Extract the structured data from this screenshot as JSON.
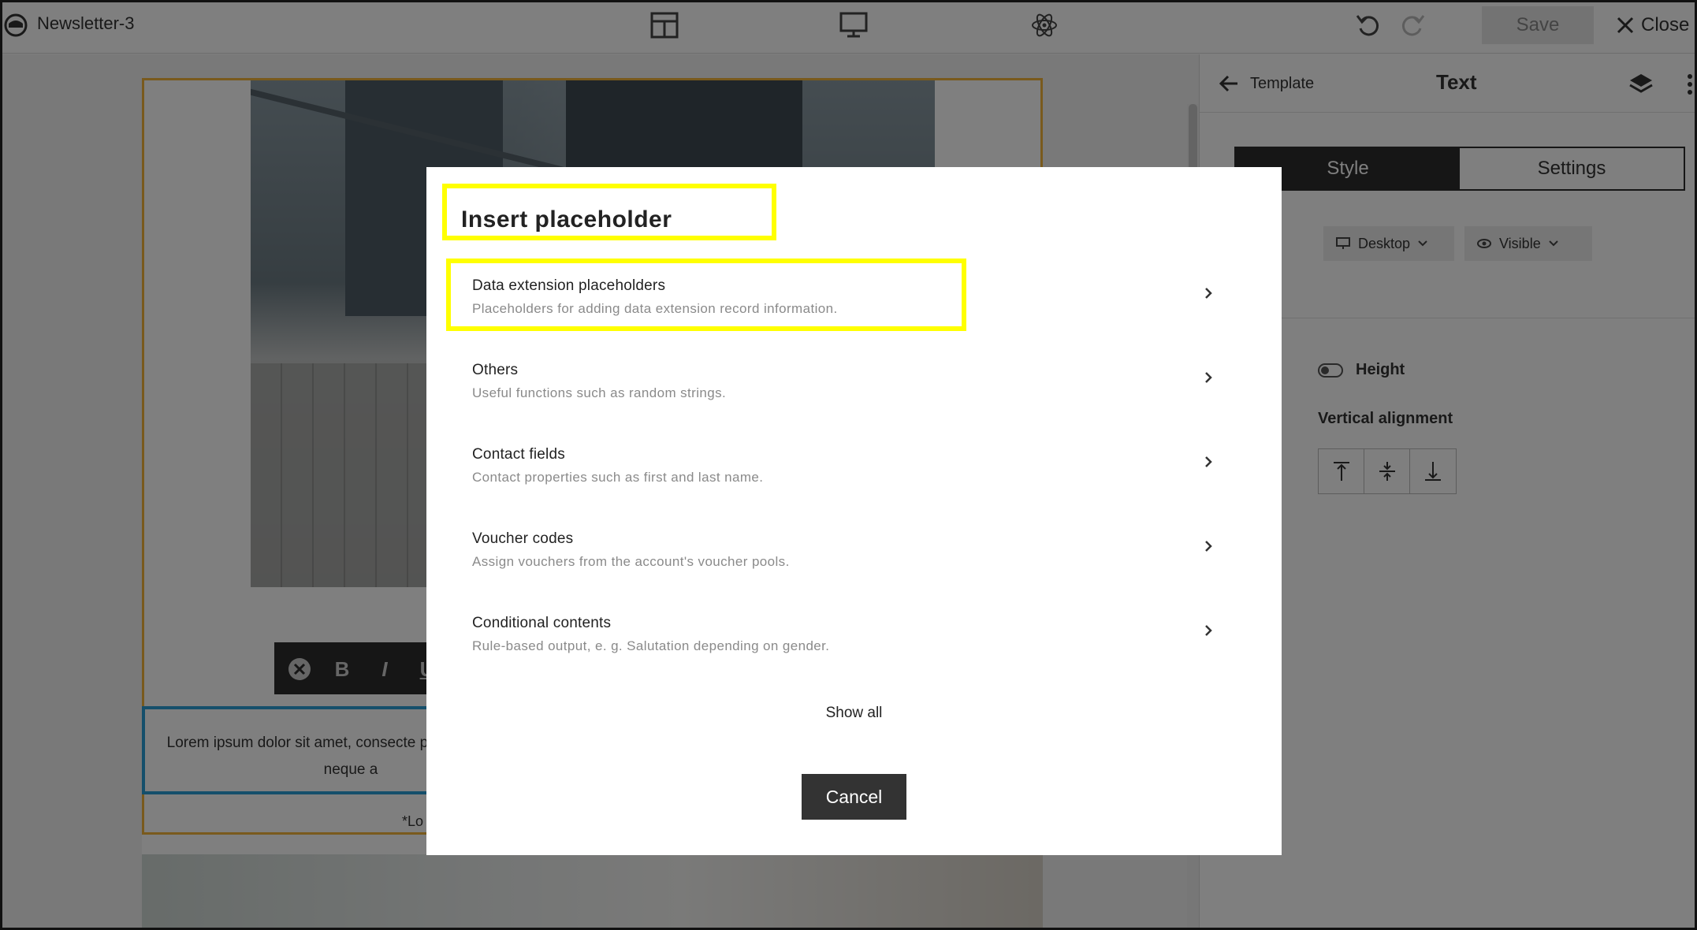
{
  "app": {
    "document_title": "Newsletter-3",
    "save_label": "Save",
    "close_label": "Close"
  },
  "canvas": {
    "text_block": "Lorem ipsum dolor sit amet, consecte porttitor massa id neque a",
    "fine_print": "*Lo"
  },
  "panel": {
    "back_label": "Template",
    "title": "Text",
    "tabs": [
      {
        "label": "Style",
        "active": true
      },
      {
        "label": "Settings",
        "active": false
      }
    ],
    "device_dropdown": "Desktop",
    "visibility_dropdown": "Visible",
    "height_label": "Height",
    "vertical_alignment_label": "Vertical alignment"
  },
  "modal": {
    "title": "Insert placeholder",
    "items": [
      {
        "label": "Data extension placeholders",
        "description": "Placeholders for adding data extension record information."
      },
      {
        "label": "Others",
        "description": "Useful functions such as random strings."
      },
      {
        "label": "Contact fields",
        "description": "Contact properties such as first and last name."
      },
      {
        "label": "Voucher codes",
        "description": "Assign vouchers from the account's voucher pools."
      },
      {
        "label": "Conditional contents",
        "description": "Rule-based output, e. g. Salutation depending on gender."
      }
    ],
    "show_all_label": "Show all",
    "cancel_label": "Cancel"
  },
  "colors": {
    "highlight": "#ffff00",
    "selection_border": "#f2b43b",
    "text_block_border": "#2a9fd6",
    "dark_button": "#333333"
  }
}
